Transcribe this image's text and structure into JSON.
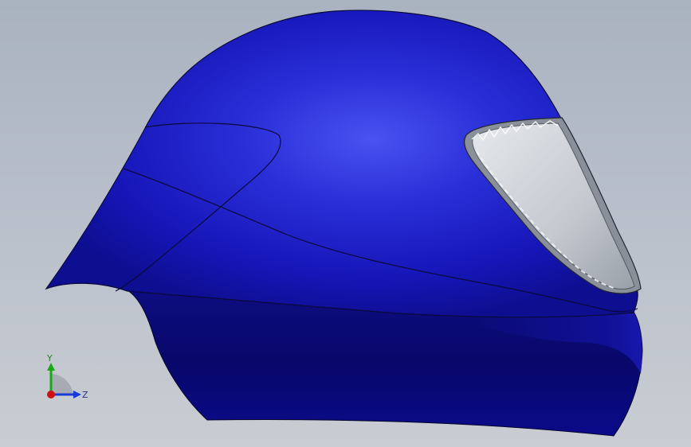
{
  "viewport": {
    "background_top": "#a9b2bf",
    "background_bottom": "#c9cdd3"
  },
  "model": {
    "shell_color": "#1a1ab4",
    "visor_color": "#c8ccd2",
    "edge_color": "#0a0a3a"
  },
  "triad": {
    "y_label": "Y",
    "z_label": "Z",
    "x_color": "#d01010",
    "y_color": "#18a818",
    "z_color": "#1a3ad8"
  }
}
